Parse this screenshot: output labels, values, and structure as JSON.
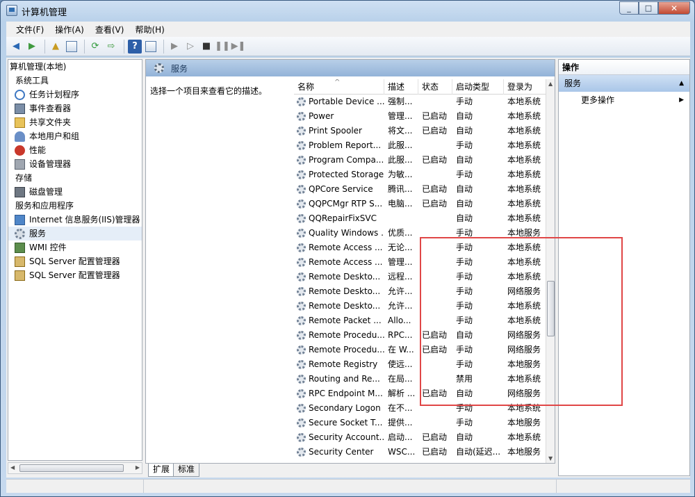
{
  "window": {
    "title": "计算机管理"
  },
  "menu": [
    "文件(F)",
    "操作(A)",
    "查看(V)",
    "帮助(H)"
  ],
  "toolbar": {
    "icons": [
      "back-icon",
      "forward-icon",
      "up-folder-icon",
      "show-hide-tree-icon",
      "refresh-icon",
      "export-icon",
      "help-icon",
      "properties-icon",
      "start-icon",
      "start-alt-icon",
      "stop-icon",
      "pause-icon",
      "restart-icon"
    ]
  },
  "tree": {
    "root": "算机管理(本地)",
    "system_tools": "系统工具",
    "task_scheduler": "任务计划程序",
    "event_viewer": "事件查看器",
    "shared_folders": "共享文件夹",
    "local_users": "本地用户和组",
    "performance": "性能",
    "device_manager": "设备管理器",
    "storage": "存储",
    "disk_management": "磁盘管理",
    "services_apps": "服务和应用程序",
    "iis": "Internet 信息服务(IIS)管理器",
    "services": "服务",
    "wmi": "WMI 控件",
    "sql1": "SQL Server 配置管理器",
    "sql2": "SQL Server 配置管理器"
  },
  "center": {
    "header_title": "服务",
    "description": "选择一个项目来查看它的描述。",
    "columns": {
      "name": "名称",
      "desc": "描述",
      "state": "状态",
      "startup": "启动类型",
      "logon": "登录为"
    },
    "rows": [
      {
        "name": "Portable Device ...",
        "desc": "强制...",
        "state": "",
        "startup": "手动",
        "logon": "本地系统"
      },
      {
        "name": "Power",
        "desc": "管理...",
        "state": "已启动",
        "startup": "自动",
        "logon": "本地系统"
      },
      {
        "name": "Print Spooler",
        "desc": "将文...",
        "state": "已启动",
        "startup": "自动",
        "logon": "本地系统"
      },
      {
        "name": "Problem Report...",
        "desc": "此服...",
        "state": "",
        "startup": "手动",
        "logon": "本地系统"
      },
      {
        "name": "Program Compa...",
        "desc": "此服...",
        "state": "已启动",
        "startup": "自动",
        "logon": "本地系统"
      },
      {
        "name": "Protected Storage",
        "desc": "为敏...",
        "state": "",
        "startup": "手动",
        "logon": "本地系统"
      },
      {
        "name": "QPCore Service",
        "desc": "腾讯...",
        "state": "已启动",
        "startup": "自动",
        "logon": "本地系统"
      },
      {
        "name": "QQPCMgr RTP S...",
        "desc": "电脑...",
        "state": "已启动",
        "startup": "自动",
        "logon": "本地系统"
      },
      {
        "name": "QQRepairFixSVC",
        "desc": "",
        "state": "",
        "startup": "自动",
        "logon": "本地系统"
      },
      {
        "name": "Quality Windows ...",
        "desc": "优质...",
        "state": "",
        "startup": "手动",
        "logon": "本地服务"
      },
      {
        "name": "Remote Access ...",
        "desc": "无论...",
        "state": "",
        "startup": "手动",
        "logon": "本地系统"
      },
      {
        "name": "Remote Access ...",
        "desc": "管理...",
        "state": "",
        "startup": "手动",
        "logon": "本地系统"
      },
      {
        "name": "Remote Deskto...",
        "desc": "远程...",
        "state": "",
        "startup": "手动",
        "logon": "本地系统"
      },
      {
        "name": "Remote Deskto...",
        "desc": "允许...",
        "state": "",
        "startup": "手动",
        "logon": "网络服务"
      },
      {
        "name": "Remote Deskto...",
        "desc": "允许...",
        "state": "",
        "startup": "手动",
        "logon": "本地系统"
      },
      {
        "name": "Remote Packet ...",
        "desc": "Allo...",
        "state": "",
        "startup": "手动",
        "logon": "本地系统"
      },
      {
        "name": "Remote Procedu...",
        "desc": "RPC...",
        "state": "已启动",
        "startup": "自动",
        "logon": "网络服务"
      },
      {
        "name": "Remote Procedu...",
        "desc": "在 W...",
        "state": "已启动",
        "startup": "手动",
        "logon": "网络服务"
      },
      {
        "name": "Remote Registry",
        "desc": "使远...",
        "state": "",
        "startup": "手动",
        "logon": "本地服务"
      },
      {
        "name": "Routing and Re...",
        "desc": "在局...",
        "state": "",
        "startup": "禁用",
        "logon": "本地系统"
      },
      {
        "name": "RPC Endpoint M...",
        "desc": "解析 ...",
        "state": "已启动",
        "startup": "自动",
        "logon": "网络服务"
      },
      {
        "name": "Secondary Logon",
        "desc": "在不...",
        "state": "",
        "startup": "手动",
        "logon": "本地系统"
      },
      {
        "name": "Secure Socket T...",
        "desc": "提供...",
        "state": "",
        "startup": "手动",
        "logon": "本地服务"
      },
      {
        "name": "Security Account...",
        "desc": "启动...",
        "state": "已启动",
        "startup": "自动",
        "logon": "本地系统"
      },
      {
        "name": "Security Center",
        "desc": "WSC...",
        "state": "已启动",
        "startup": "自动(延迟...",
        "logon": "本地服务"
      }
    ],
    "tabs": [
      "扩展",
      "标准"
    ]
  },
  "actions": {
    "header": "操作",
    "section": "服务",
    "more": "更多操作"
  },
  "colors": {
    "highlight": "#e04646",
    "header_blue": "#93b3d8"
  }
}
